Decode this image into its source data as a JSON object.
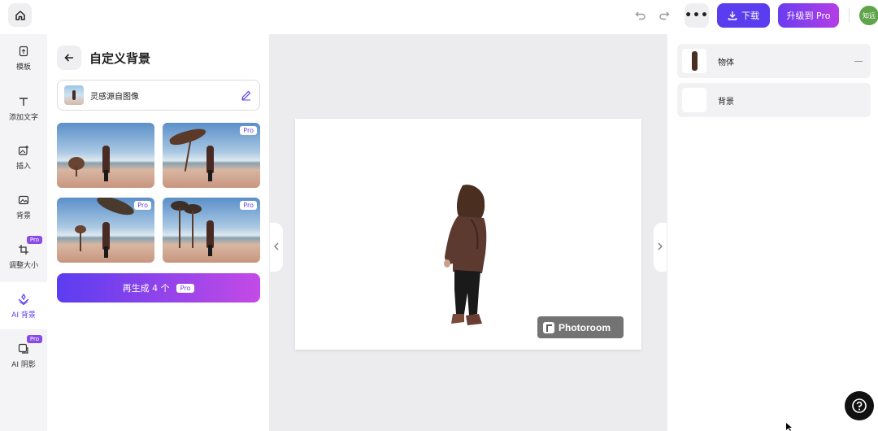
{
  "topbar": {
    "download_label": "下载",
    "upgrade_label": "升级到 Pro",
    "more_label": "•••",
    "avatar_text": "知远"
  },
  "rail": {
    "items": [
      {
        "label": "模板",
        "icon": "template-icon"
      },
      {
        "label": "添加文字",
        "icon": "text-icon"
      },
      {
        "label": "插入",
        "icon": "insert-image-icon"
      },
      {
        "label": "背景",
        "icon": "background-icon"
      },
      {
        "label": "调整大小",
        "icon": "resize-icon",
        "pro": "Pro"
      },
      {
        "label": "AI 背景",
        "icon": "ai-background-icon",
        "active": true
      },
      {
        "label": "AI 阴影",
        "icon": "ai-shadow-icon",
        "pro": "Pro"
      }
    ]
  },
  "panel": {
    "title": "自定义背景",
    "inspire_label": "灵感源自图像",
    "thumbnails": [
      {
        "pro": ""
      },
      {
        "pro": "Pro"
      },
      {
        "pro": "Pro"
      },
      {
        "pro": "Pro"
      }
    ],
    "generate_label": "再生成 4 个",
    "generate_pro": "Pro"
  },
  "canvas": {
    "watermark_text": "Photoroom"
  },
  "layers": [
    {
      "label": "物体"
    },
    {
      "label": "背景"
    }
  ],
  "colors": {
    "accent": "#5b3df0",
    "accent_gradient_end": "#c44ae6"
  }
}
